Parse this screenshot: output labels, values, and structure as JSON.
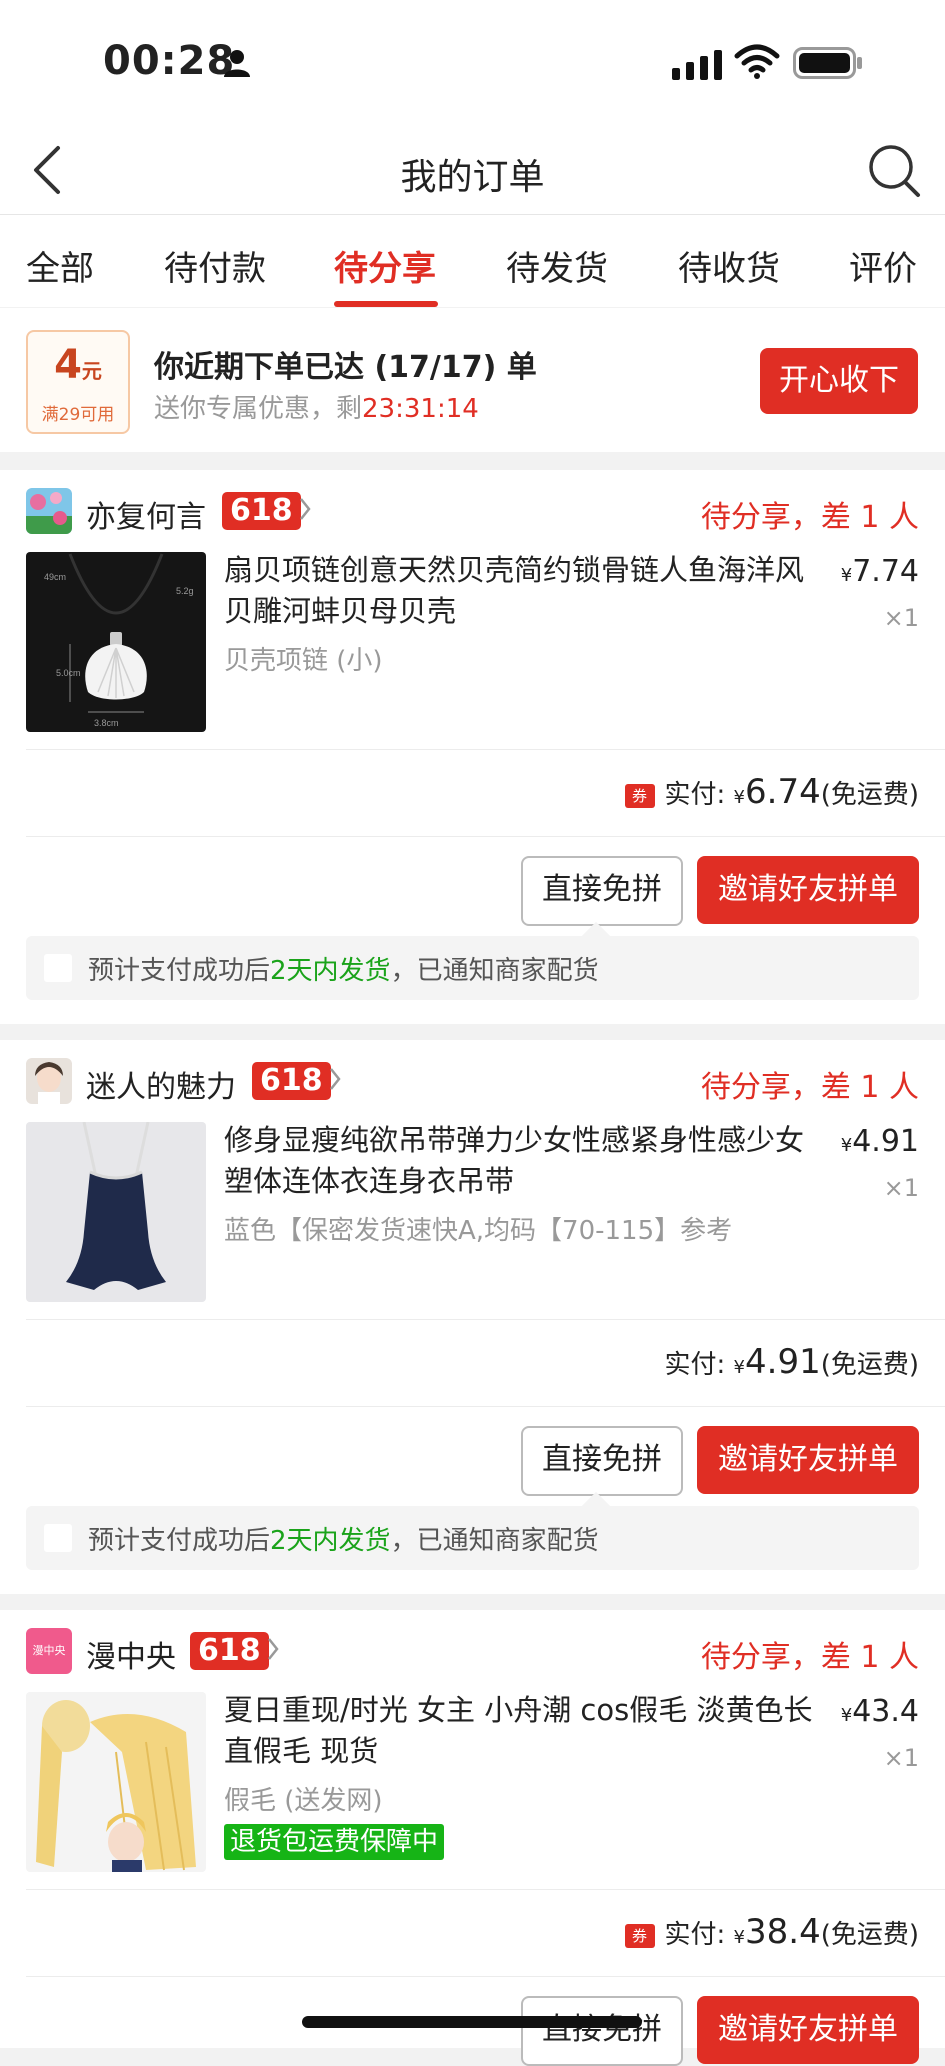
{
  "status_bar": {
    "time": "00:28"
  },
  "nav": {
    "title": "我的订单"
  },
  "tabs": [
    "全部",
    "待付款",
    "待分享",
    "待发货",
    "待收货",
    "评价"
  ],
  "active_tab": "待分享",
  "coupon": {
    "value": "4",
    "unit": "元",
    "condition": "满29可用",
    "title": "你近期下单已达 (17/17) 单",
    "subtitle_prefix": "送你专属优惠，剩",
    "countdown": "23:31:14",
    "button": "开心收下"
  },
  "orders": [
    {
      "shop": "亦复何言",
      "badge": "618",
      "status": "待分享，差 1 人",
      "title": "扇贝项链创意天然贝壳简约锁骨链人鱼海洋风贝雕河蚌贝母贝壳",
      "spec": "贝壳项链 (小)",
      "currency": "¥",
      "price": "7.74",
      "qty": "×1",
      "coupon_tag": "券",
      "paid_label": "实付:",
      "paid": "6.74",
      "shipping_note": "(免运费)",
      "btn_direct": "直接免拼",
      "btn_invite": "邀请好友拼单",
      "ship_prefix": "预计支付成功后",
      "ship_highlight": "2天内发货",
      "ship_suffix": "，已通知商家配货",
      "thumb_labels": {
        "width": "49cm",
        "len": "5.2g",
        "h": "5.0cm",
        "w": "3.8cm"
      }
    },
    {
      "shop": "迷人的魅力",
      "badge": "618",
      "status": "待分享，差 1 人",
      "title": "修身显瘦纯欲吊带弹力少女性感紧身性感少女塑体连体衣连身衣吊带",
      "spec": "蓝色【保密发货速快A,均码【70-115】参考",
      "currency": "¥",
      "price": "4.91",
      "qty": "×1",
      "paid_label": "实付:",
      "paid": "4.91",
      "shipping_note": "(免运费)",
      "btn_direct": "直接免拼",
      "btn_invite": "邀请好友拼单",
      "ship_prefix": "预计支付成功后",
      "ship_highlight": "2天内发货",
      "ship_suffix": "，已通知商家配货"
    },
    {
      "shop": "漫中央",
      "shop_logo_text": "漫中央",
      "badge": "618",
      "status": "待分享，差 1 人",
      "title": "夏日重现/时光 女主 小舟潮 cos假毛  淡黄色长直假毛 现货",
      "spec": "假毛 (送发网)",
      "tag": "退货包运费保障中",
      "currency": "¥",
      "price": "43.4",
      "qty": "×1",
      "coupon_tag": "券",
      "paid_label": "实付:",
      "paid": "38.4",
      "shipping_note": "(免运费)",
      "btn_direct": "直接免拼",
      "btn_invite": "邀请好友拼单"
    }
  ],
  "colors": {
    "accent": "#e02e24",
    "green": "#1aa31a"
  }
}
